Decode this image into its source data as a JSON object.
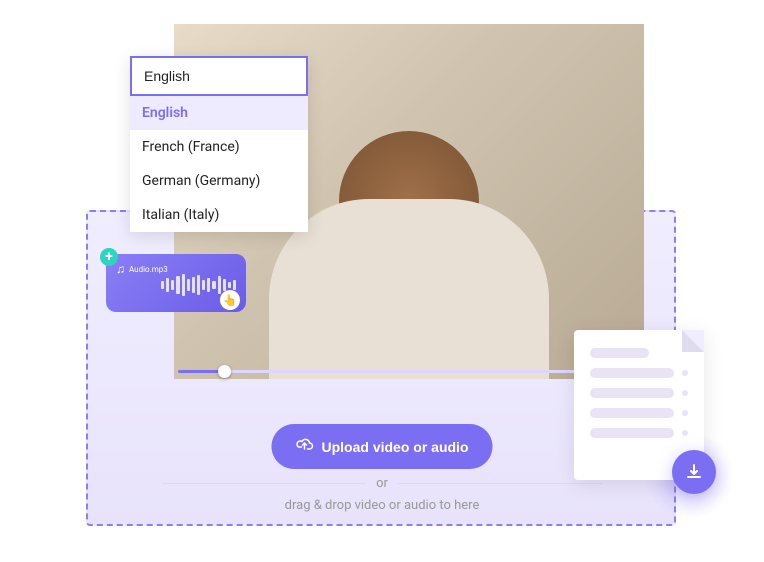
{
  "language": {
    "current": "English",
    "options": [
      "English",
      "French (France)",
      "German (Germany)",
      "Italian (Italy)"
    ]
  },
  "audio": {
    "filename": "Audio.mp3"
  },
  "upload": {
    "button_label": "Upload video or audio",
    "or_text": "or",
    "drag_hint": "drag & drop video or audio to here"
  },
  "colors": {
    "primary": "#7c6ef2",
    "accent": "#2dd4bf"
  }
}
